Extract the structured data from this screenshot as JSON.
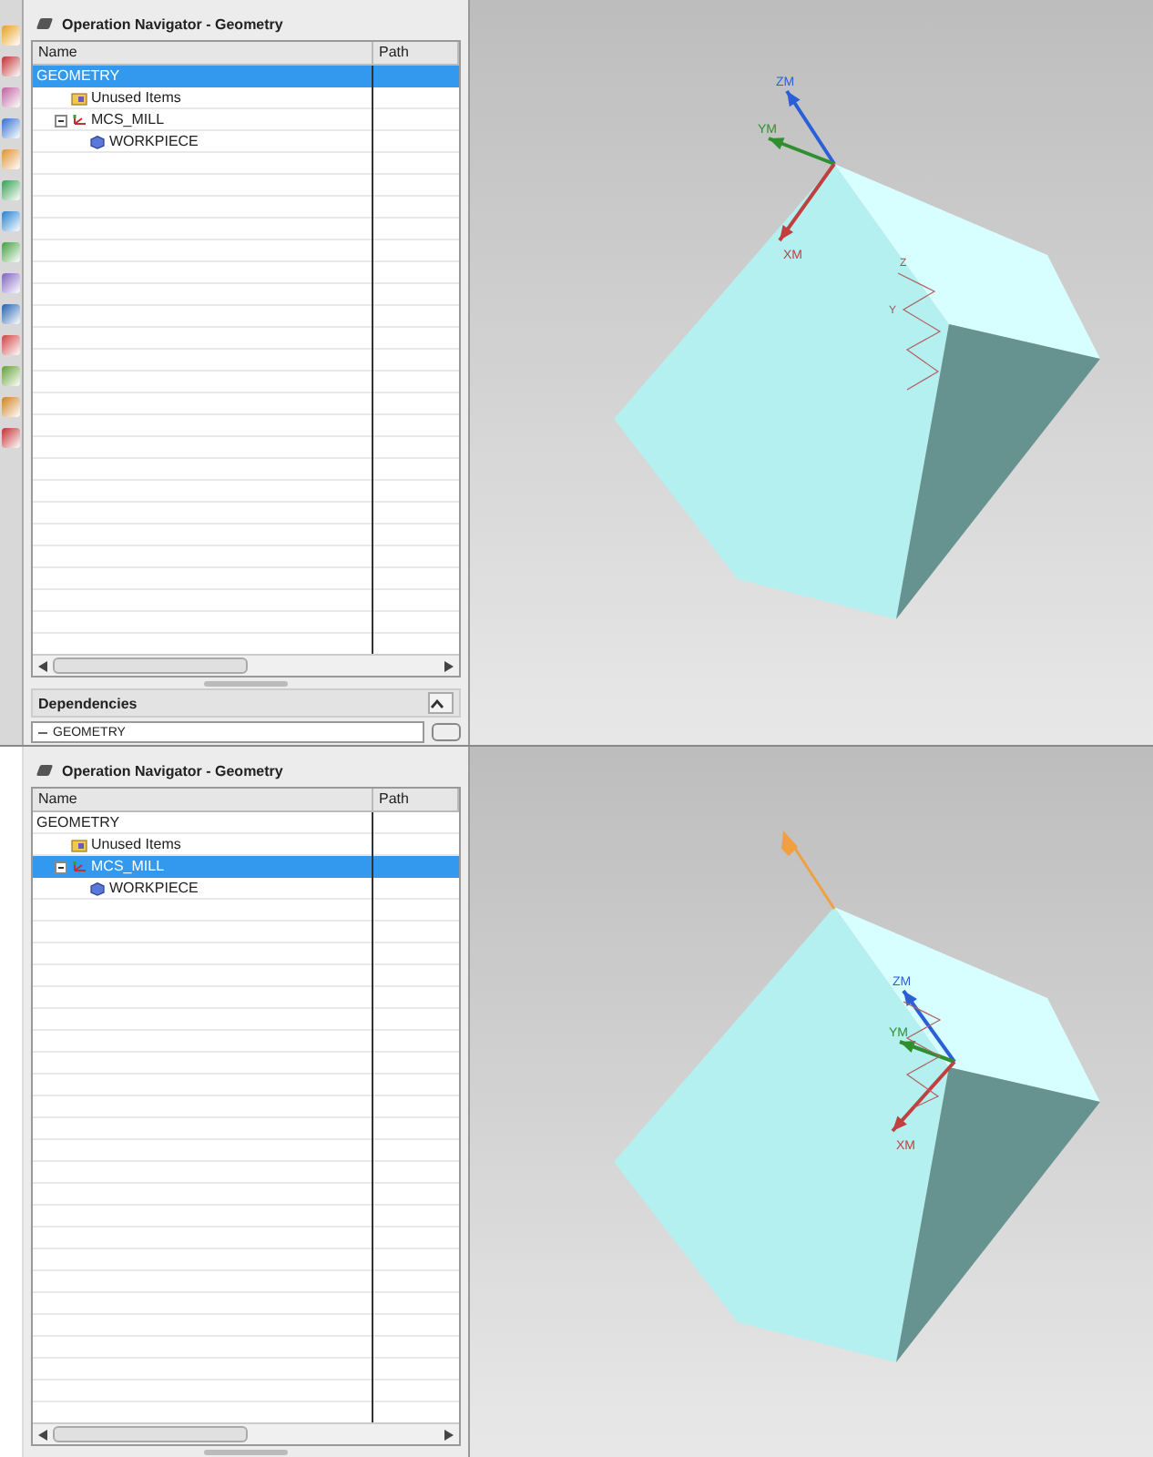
{
  "panes": [
    {
      "show_toolbar": true,
      "navigator": {
        "title": "Operation Navigator - Geometry",
        "columns": [
          "Name",
          "Path"
        ],
        "tree": [
          {
            "label": "GEOMETRY",
            "selected": true,
            "children": [
              {
                "label": "Unused Items",
                "kind": "folder",
                "selected": false
              },
              {
                "label": "MCS_MILL",
                "kind": "mcs",
                "selected": false,
                "expanded": true,
                "children": [
                  {
                    "label": "WORKPIECE",
                    "kind": "workpiece",
                    "selected": false
                  }
                ]
              }
            ]
          }
        ]
      },
      "dependencies": {
        "title": "Dependencies",
        "value": "GEOMETRY"
      },
      "viewport": {
        "axes": [
          {
            "label": "ZM",
            "kind": "z",
            "color": "#2a5fd8"
          },
          {
            "label": "YM",
            "kind": "y",
            "color": "#2f8f2f"
          },
          {
            "label": "XM",
            "kind": "x",
            "color": "#c04040"
          }
        ],
        "handle_labels": [
          "Z",
          "Y"
        ]
      }
    },
    {
      "show_toolbar": false,
      "navigator": {
        "title": "Operation Navigator - Geometry",
        "columns": [
          "Name",
          "Path"
        ],
        "tree": [
          {
            "label": "GEOMETRY",
            "selected": false,
            "children": [
              {
                "label": "Unused Items",
                "kind": "folder",
                "selected": false
              },
              {
                "label": "MCS_MILL",
                "kind": "mcs",
                "selected": true,
                "expanded": true,
                "children": [
                  {
                    "label": "WORKPIECE",
                    "kind": "workpiece",
                    "selected": false
                  }
                ]
              }
            ]
          }
        ]
      },
      "viewport": {
        "axes": [
          {
            "label": "ZM",
            "kind": "z",
            "color": "#2a5fd8"
          },
          {
            "label": "YM",
            "kind": "y",
            "color": "#2f8f2f"
          },
          {
            "label": "XM",
            "kind": "x",
            "color": "#c04040"
          }
        ],
        "orange_handle": true
      }
    }
  ]
}
